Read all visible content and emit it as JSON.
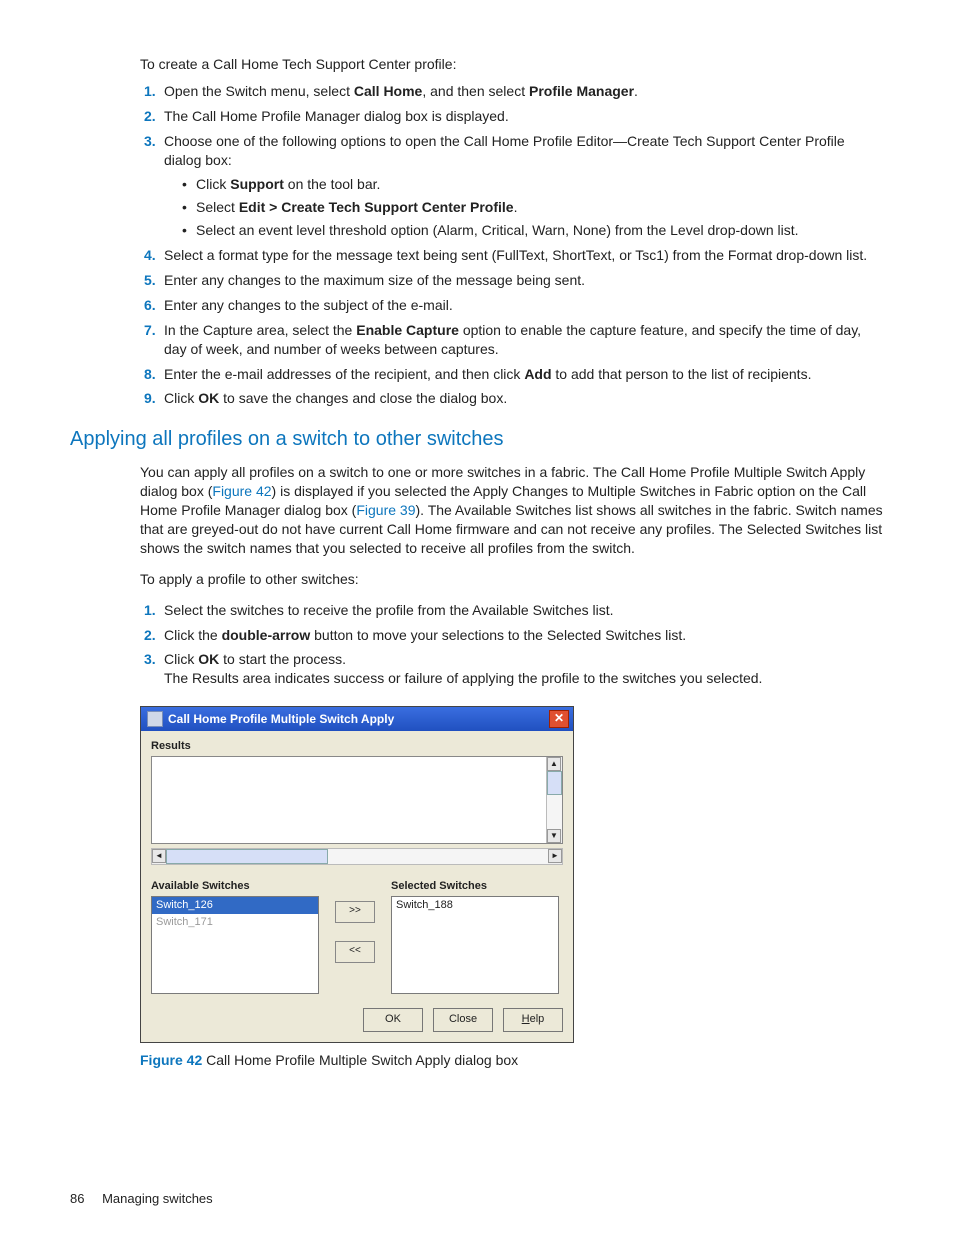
{
  "intro1": "To create a Call Home Tech Support Center profile:",
  "s1": {
    "a": "Open the Switch menu, select ",
    "b": "Call Home",
    "c": ", and then select ",
    "d": "Profile Manager",
    "e": "."
  },
  "s2": "The Call Home Profile Manager dialog box is displayed.",
  "s3": {
    "a": "Choose one of the following options to open the Call Home Profile Editor—Create Tech Support Center Profile dialog box:",
    "b1a": "Click ",
    "b1b": "Support",
    "b1c": " on the tool bar.",
    "b2a": "Select ",
    "b2b": "Edit > Create Tech Support Center Profile",
    "b2c": ".",
    "b3": "Select an event level threshold option (Alarm, Critical, Warn, None) from the Level drop-down list."
  },
  "s4": "Select a format type for the message text being sent (FullText, ShortText, or Tsc1) from the Format drop-down list.",
  "s5": "Enter any changes to the maximum size of the message being sent.",
  "s6": "Enter any changes to the subject of the e-mail.",
  "s7": {
    "a": "In the Capture area, select the ",
    "b": "Enable Capture",
    "c": " option to enable the capture feature, and specify the time of day, day of week, and number of weeks between captures."
  },
  "s8": {
    "a": "Enter the e-mail addresses of the recipient, and then click ",
    "b": "Add",
    "c": " to add that person to the list of recipients."
  },
  "s9": {
    "a": "Click ",
    "b": "OK",
    "c": " to save the changes and close the dialog box."
  },
  "section_heading": "Applying all profiles on a switch to other switches",
  "p1": {
    "a": "You can apply all profiles on a switch to one or more switches in a fabric. The Call Home Profile Multiple Switch Apply dialog box (",
    "link1": "Figure 42",
    "b": ") is displayed if you selected the Apply Changes to Multiple Switches in Fabric option on the Call Home Profile Manager dialog box (",
    "link2": "Figure 39",
    "c": "). The Available Switches list shows all switches in the fabric. Switch names that are greyed-out do not have current Call Home firmware and can not receive any profiles. The Selected Switches list shows the switch names that you selected to receive all profiles from the switch."
  },
  "intro2": "To apply a profile to other switches:",
  "a1": "Select the switches to receive the profile from the Available Switches list.",
  "a2": {
    "a": "Click the ",
    "b": "double-arrow",
    "c": " button to move your selections to the Selected Switches list."
  },
  "a3": {
    "a": "Click ",
    "b": "OK",
    "c": " to start the process.",
    "d": "The Results area indicates success or failure of applying the profile to the switches you selected."
  },
  "dialog": {
    "title": "Call Home Profile Multiple Switch Apply",
    "results_label": "Results",
    "available_label": "Available Switches",
    "selected_label": "Selected Switches",
    "available_items": {
      "i0": "Switch_126",
      "i1": "Switch_171"
    },
    "selected_items": {
      "i0": "Switch_188"
    },
    "btn_right": ">>",
    "btn_left": "<<",
    "ok": "OK",
    "close": "Close",
    "help": "Help"
  },
  "figure": {
    "num": "Figure 42",
    "caption": " Call Home Profile Multiple Switch Apply dialog box"
  },
  "footer": {
    "page": "86",
    "section": "Managing switches"
  }
}
